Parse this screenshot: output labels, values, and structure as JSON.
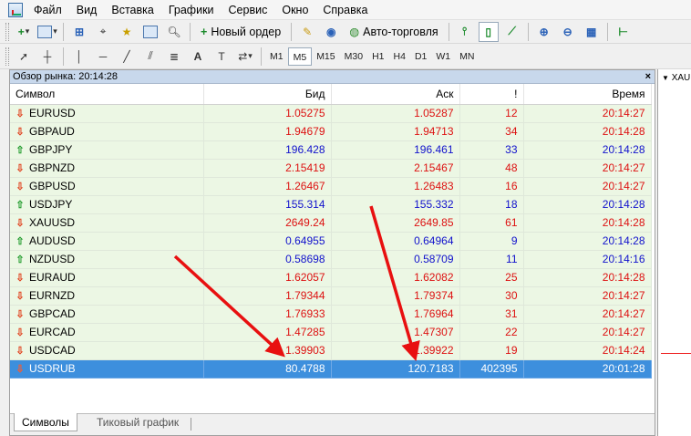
{
  "menu": [
    "Файл",
    "Вид",
    "Вставка",
    "Графики",
    "Сервис",
    "Окно",
    "Справка"
  ],
  "toolbar": {
    "new_order_label": "Новый ордер",
    "autotrading_label": "Авто-торговля"
  },
  "timeframes": [
    "M1",
    "M5",
    "M15",
    "M30",
    "H1",
    "H4",
    "D1",
    "W1",
    "MN"
  ],
  "active_timeframe": "M5",
  "market_watch": {
    "title": "Обзор рынка: 20:14:28",
    "close_glyph": "×",
    "columns": {
      "symbol": "Символ",
      "bid": "Бид",
      "ask": "Аск",
      "spread": "!",
      "time": "Время"
    },
    "rows": [
      {
        "symbol": "EURUSD",
        "bid": "1.05275",
        "ask": "1.05287",
        "spread": "12",
        "time": "20:14:27",
        "dir": "down",
        "color": "red"
      },
      {
        "symbol": "GBPAUD",
        "bid": "1.94679",
        "ask": "1.94713",
        "spread": "34",
        "time": "20:14:28",
        "dir": "down",
        "color": "red"
      },
      {
        "symbol": "GBPJPY",
        "bid": "196.428",
        "ask": "196.461",
        "spread": "33",
        "time": "20:14:28",
        "dir": "up",
        "color": "blue"
      },
      {
        "symbol": "GBPNZD",
        "bid": "2.15419",
        "ask": "2.15467",
        "spread": "48",
        "time": "20:14:27",
        "dir": "down",
        "color": "red"
      },
      {
        "symbol": "GBPUSD",
        "bid": "1.26467",
        "ask": "1.26483",
        "spread": "16",
        "time": "20:14:27",
        "dir": "down",
        "color": "red"
      },
      {
        "symbol": "USDJPY",
        "bid": "155.314",
        "ask": "155.332",
        "spread": "18",
        "time": "20:14:28",
        "dir": "up",
        "color": "blue"
      },
      {
        "symbol": "XAUUSD",
        "bid": "2649.24",
        "ask": "2649.85",
        "spread": "61",
        "time": "20:14:28",
        "dir": "down",
        "color": "red"
      },
      {
        "symbol": "AUDUSD",
        "bid": "0.64955",
        "ask": "0.64964",
        "spread": "9",
        "time": "20:14:28",
        "dir": "up",
        "color": "blue"
      },
      {
        "symbol": "NZDUSD",
        "bid": "0.58698",
        "ask": "0.58709",
        "spread": "11",
        "time": "20:14:16",
        "dir": "up",
        "color": "blue"
      },
      {
        "symbol": "EURAUD",
        "bid": "1.62057",
        "ask": "1.62082",
        "spread": "25",
        "time": "20:14:28",
        "dir": "down",
        "color": "red"
      },
      {
        "symbol": "EURNZD",
        "bid": "1.79344",
        "ask": "1.79374",
        "spread": "30",
        "time": "20:14:27",
        "dir": "down",
        "color": "red"
      },
      {
        "symbol": "GBPCAD",
        "bid": "1.76933",
        "ask": "1.76964",
        "spread": "31",
        "time": "20:14:27",
        "dir": "down",
        "color": "red"
      },
      {
        "symbol": "EURCAD",
        "bid": "1.47285",
        "ask": "1.47307",
        "spread": "22",
        "time": "20:14:27",
        "dir": "down",
        "color": "red"
      },
      {
        "symbol": "USDCAD",
        "bid": "1.39903",
        "ask": "1.39922",
        "spread": "19",
        "time": "20:14:24",
        "dir": "down",
        "color": "red"
      },
      {
        "symbol": "USDRUB",
        "bid": "80.4788",
        "ask": "120.7183",
        "spread": "402395",
        "time": "20:01:28",
        "dir": "down",
        "color": "selected"
      }
    ],
    "tabs": [
      "Символы",
      "Тиковый график"
    ]
  },
  "chart_panel": {
    "symbol_prefix": "XAU"
  },
  "colors": {
    "annotation_arrow": "#e81010",
    "selected_row": "#3d8fdd",
    "row_bg": "#ecf7e4"
  }
}
